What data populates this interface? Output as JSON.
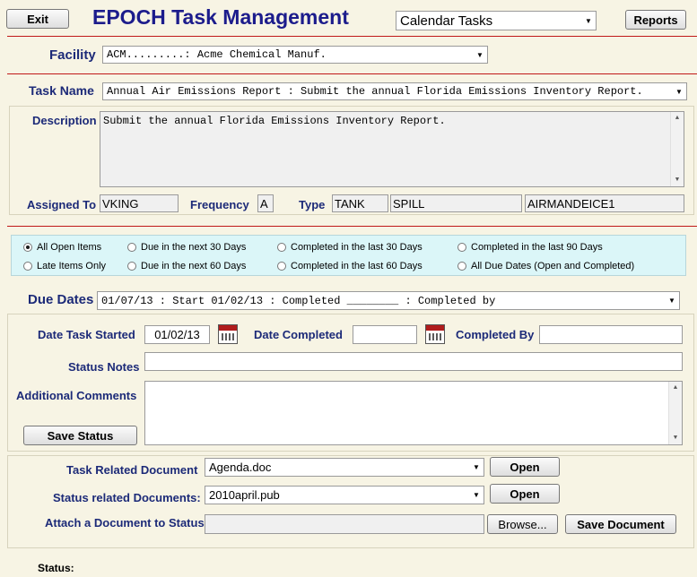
{
  "header": {
    "exit_label": "Exit",
    "title": "EPOCH Task Management",
    "view_select": "Calendar Tasks",
    "reports_label": "Reports"
  },
  "facility": {
    "label": "Facility",
    "value": "ACM.........: Acme Chemical Manuf."
  },
  "task": {
    "name_label": "Task Name",
    "name_value": "Annual Air Emissions Report : Submit the annual Florida Emissions Inventory Report.",
    "description_label": "Description",
    "description_value": "Submit the annual Florida Emissions Inventory Report.",
    "assigned_label": "Assigned To",
    "assigned_value": "VKING",
    "frequency_label": "Frequency",
    "frequency_value": "A",
    "type_label": "Type",
    "type_values": [
      "TANK",
      "SPILL",
      "AIRMANDEICE1"
    ]
  },
  "filters": {
    "options": [
      {
        "label": "All Open Items",
        "selected": true
      },
      {
        "label": "Due in the next 30 Days",
        "selected": false
      },
      {
        "label": "Completed in the last 30 Days",
        "selected": false
      },
      {
        "label": "Completed in the last 90 Days",
        "selected": false
      },
      {
        "label": "Late Items Only",
        "selected": false
      },
      {
        "label": "Due in the next 60 Days",
        "selected": false
      },
      {
        "label": "Completed in the last 60 Days",
        "selected": false
      },
      {
        "label": "All Due Dates (Open and Completed)",
        "selected": false
      }
    ]
  },
  "due_dates": {
    "label": "Due Dates",
    "value": "01/07/13 : Start 01/02/13 : Completed ________ : Completed by"
  },
  "status": {
    "date_started_label": "Date Task Started",
    "date_started_value": "01/02/13",
    "date_completed_label": "Date Completed",
    "date_completed_value": "",
    "completed_by_label": "Completed By",
    "completed_by_value": "",
    "notes_label": "Status Notes",
    "notes_value": "",
    "comments_label": "Additional Comments",
    "comments_value": "",
    "save_label": "Save Status"
  },
  "documents": {
    "task_doc_label": "Task Related Document",
    "task_doc_value": "Agenda.doc",
    "status_docs_label": "Status related Documents:",
    "status_docs_value": "2010april.pub",
    "open_label": "Open",
    "attach_label": "Attach a Document to Status",
    "attach_value": "",
    "browse_label": "Browse...",
    "save_doc_label": "Save Document"
  },
  "footer": {
    "status_label": "Status:"
  },
  "icons": {
    "calendar": "calendar-icon",
    "dropdown": "chevron-down-icon"
  },
  "colors": {
    "background": "#f7f4e4",
    "title": "#1c1c8c",
    "divider": "#c01818",
    "filter_panel": "#dbf6f8"
  }
}
